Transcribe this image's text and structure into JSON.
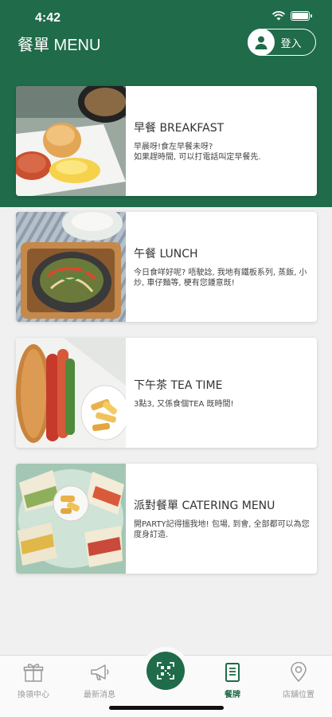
{
  "status_bar": {
    "time": "4:42"
  },
  "header": {
    "title": "餐單 MENU",
    "login_label": "登入"
  },
  "menu": [
    {
      "title": "早餐 BREAKFAST",
      "desc": "早晨呀!食左早餐未呀?\n如果趕時間, 可以打電話叫定早餐先."
    },
    {
      "title": "午餐 LUNCH",
      "desc": "今日食咩好呢? 唔駛諗, 我地有鐵板系列, 蒸飯, 小炒, 車仔麵等, 梗有您鍾意既!"
    },
    {
      "title": "下午茶 TEA TIME",
      "desc": "3點3, 又係食個TEA 既時間!"
    },
    {
      "title": "派對餐單 CATERING MENU",
      "desc": "開PARTY記得搵我地! 包場, 到會, 全部都可以為您度身訂造."
    }
  ],
  "tabbar": {
    "tabs": [
      {
        "label": "換領中心",
        "icon": "gift-icon"
      },
      {
        "label": "最新消息",
        "icon": "megaphone-icon"
      },
      {
        "label": "",
        "icon": "qr-scan-icon"
      },
      {
        "label": "餐牌",
        "icon": "menu-document-icon"
      },
      {
        "label": "店舖位置",
        "icon": "location-pin-icon"
      }
    ]
  },
  "colors": {
    "brand_green": "#1f6b4a",
    "background": "#f0f0f0"
  }
}
